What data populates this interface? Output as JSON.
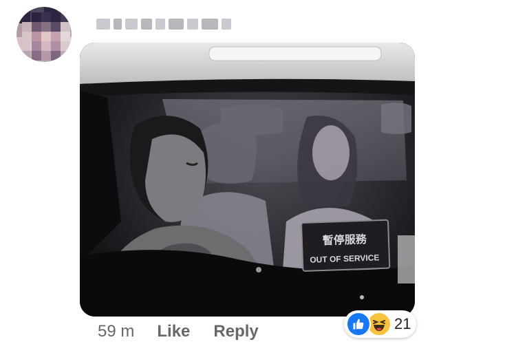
{
  "comment": {
    "author_name": "",
    "photo_sign_text_top": "暫停服務",
    "photo_sign_text_bottom": "OUT OF SERVICE",
    "time": "59 m",
    "like_label": "Like",
    "reply_label": "Reply",
    "reactions": {
      "icons": [
        "like-icon",
        "haha-icon"
      ],
      "count": "21"
    }
  },
  "colors": {
    "action_text": "#65676b",
    "like_blue": "#1877f2",
    "haha_yellow": "#f7c33f"
  }
}
